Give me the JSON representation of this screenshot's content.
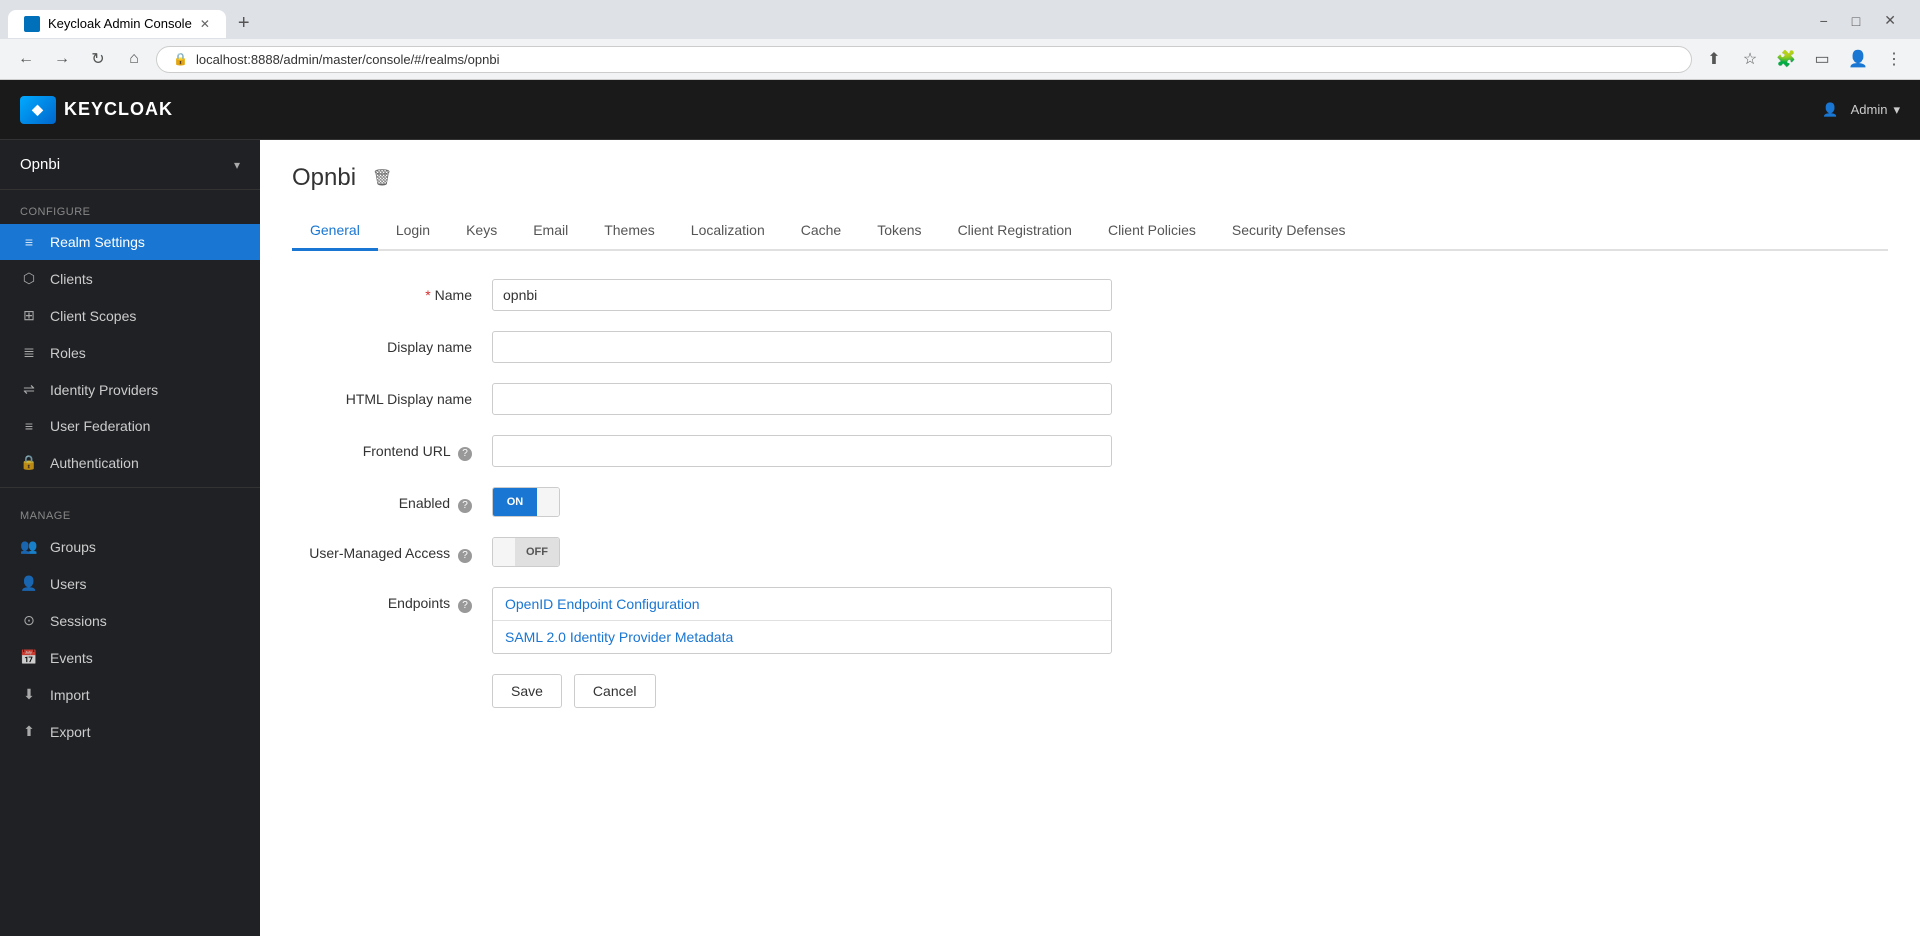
{
  "browser": {
    "tab_title": "Keycloak Admin Console",
    "tab_favicon": "KC",
    "url": "localhost:8888/admin/master/console/#/realms/opnbi",
    "new_tab_label": "+",
    "nav": {
      "back": "←",
      "forward": "→",
      "refresh": "↻",
      "home": "⌂"
    },
    "window_controls": {
      "minimize": "−",
      "maximize": "□",
      "close": "✕"
    }
  },
  "header": {
    "logo_text": "KEYCLOAK",
    "logo_icon": "◆",
    "admin_label": "Admin",
    "admin_chevron": "▾",
    "admin_icon": "👤"
  },
  "sidebar": {
    "realm_name": "Opnbi",
    "realm_chevron": "▾",
    "configure_label": "Configure",
    "manage_label": "Manage",
    "configure_items": [
      {
        "id": "realm-settings",
        "label": "Realm Settings",
        "icon": "≡",
        "active": true
      },
      {
        "id": "clients",
        "label": "Clients",
        "icon": "⬡"
      },
      {
        "id": "client-scopes",
        "label": "Client Scopes",
        "icon": "⊞"
      },
      {
        "id": "roles",
        "label": "Roles",
        "icon": "≣"
      },
      {
        "id": "identity-providers",
        "label": "Identity Providers",
        "icon": "⇌"
      },
      {
        "id": "user-federation",
        "label": "User Federation",
        "icon": "≡"
      },
      {
        "id": "authentication",
        "label": "Authentication",
        "icon": "🔒"
      }
    ],
    "manage_items": [
      {
        "id": "groups",
        "label": "Groups",
        "icon": "👥"
      },
      {
        "id": "users",
        "label": "Users",
        "icon": "👤"
      },
      {
        "id": "sessions",
        "label": "Sessions",
        "icon": "⊙"
      },
      {
        "id": "events",
        "label": "Events",
        "icon": "📅"
      },
      {
        "id": "import",
        "label": "Import",
        "icon": "⬇"
      },
      {
        "id": "export",
        "label": "Export",
        "icon": "⬆"
      }
    ]
  },
  "content": {
    "page_title": "Opnbi",
    "delete_icon": "🗑",
    "tabs": [
      {
        "id": "general",
        "label": "General",
        "active": true
      },
      {
        "id": "login",
        "label": "Login"
      },
      {
        "id": "keys",
        "label": "Keys"
      },
      {
        "id": "email",
        "label": "Email"
      },
      {
        "id": "themes",
        "label": "Themes"
      },
      {
        "id": "localization",
        "label": "Localization"
      },
      {
        "id": "cache",
        "label": "Cache"
      },
      {
        "id": "tokens",
        "label": "Tokens"
      },
      {
        "id": "client-registration",
        "label": "Client Registration"
      },
      {
        "id": "client-policies",
        "label": "Client Policies"
      },
      {
        "id": "security-defenses",
        "label": "Security Defenses"
      }
    ],
    "form": {
      "name_label": "Name",
      "name_required": "*",
      "name_value": "opnbi",
      "display_name_label": "Display name",
      "display_name_value": "",
      "html_display_name_label": "HTML Display name",
      "html_display_name_value": "",
      "frontend_url_label": "Frontend URL",
      "frontend_url_value": "",
      "frontend_url_help": "?",
      "enabled_label": "Enabled",
      "enabled_help": "?",
      "enabled_on": "ON",
      "user_managed_access_label": "User-Managed Access",
      "user_managed_access_help": "?",
      "user_managed_off": "OFF",
      "endpoints_label": "Endpoints",
      "endpoints_help": "?",
      "endpoint1": "OpenID Endpoint Configuration",
      "endpoint2": "SAML 2.0 Identity Provider Metadata",
      "save_label": "Save",
      "cancel_label": "Cancel"
    }
  }
}
